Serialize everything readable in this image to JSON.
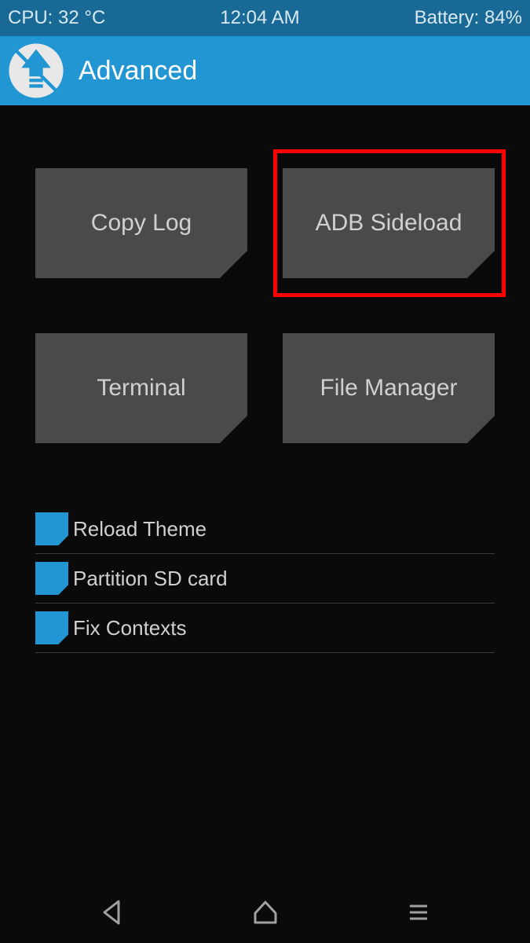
{
  "status_bar": {
    "cpu": "CPU: 32 °C",
    "time": "12:04 AM",
    "battery": "Battery: 84%"
  },
  "header": {
    "title": "Advanced"
  },
  "buttons": {
    "copy_log": "Copy Log",
    "adb_sideload": "ADB Sideload",
    "terminal": "Terminal",
    "file_manager": "File Manager"
  },
  "list_items": {
    "reload_theme": "Reload Theme",
    "partition_sd": "Partition SD card",
    "fix_contexts": "Fix Contexts"
  },
  "colors": {
    "accent": "#2196d3",
    "status_bg": "#196996",
    "button_bg": "#4a4a4a",
    "highlight": "#ff0000"
  }
}
